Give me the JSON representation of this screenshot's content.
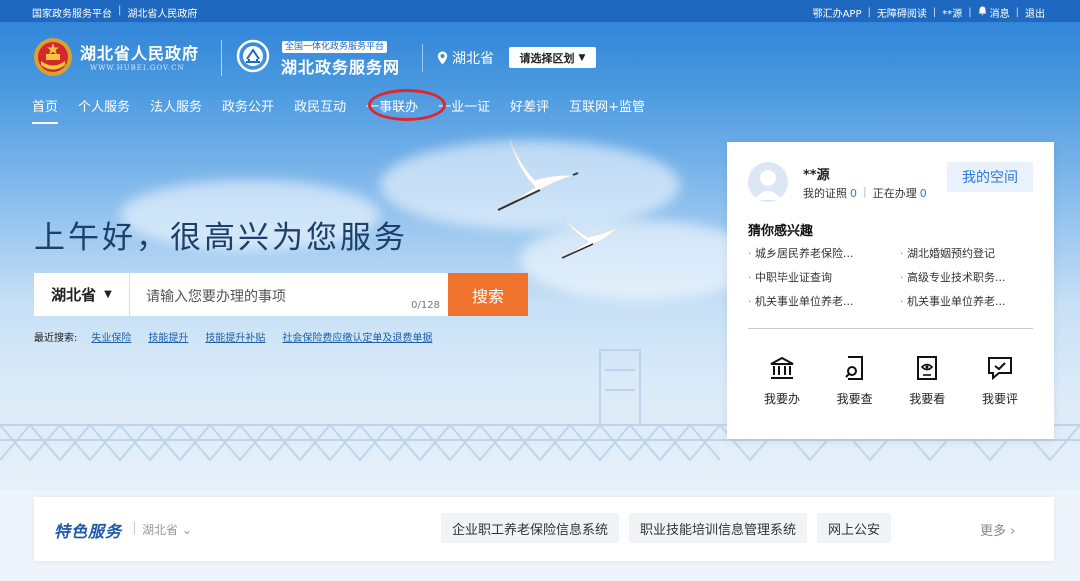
{
  "topbar": {
    "left": [
      "国家政务服务平台",
      "湖北省人民政府"
    ],
    "right": [
      "鄂汇办APP",
      "无障碍阅读",
      "**源",
      "消息",
      "退出"
    ]
  },
  "header": {
    "gov_title": "湖北省人民政府",
    "gov_url": "WWW.HUBEI.GOV.CN",
    "hall_badge": "全国一体化政务服务平台",
    "hall_title": "湖北政务服务网",
    "location": "湖北省",
    "region_select": "请选择区划"
  },
  "nav": [
    "首页",
    "个人服务",
    "法人服务",
    "政务公开",
    "政民互动",
    "一事联办",
    "一业一证",
    "好差评",
    "互联网+监管"
  ],
  "greeting": "上午好，很高兴为您服务",
  "search": {
    "region": "湖北省",
    "placeholder": "请输入您要办理的事项",
    "counter": "0/128",
    "button": "搜索"
  },
  "recent": {
    "label": "最近搜索:",
    "items": [
      "失业保险",
      "技能提升",
      "技能提升补贴",
      "社会保险费应缴认定单及退费单据"
    ]
  },
  "user_card": {
    "name": "**源",
    "cert_label": "我的证照",
    "cert_count": "0",
    "doing_label": "正在办理",
    "doing_count": "0",
    "space_button": "我的空间",
    "interest_title": "猜你感兴趣",
    "interests": [
      "城乡居民养老保险...",
      "湖北婚姻预约登记",
      "中职毕业证查询",
      "高级专业技术职务...",
      "机关事业单位养老...",
      "机关事业单位养老..."
    ],
    "actions": [
      {
        "label": "我要办",
        "icon": "building-icon"
      },
      {
        "label": "我要查",
        "icon": "search-doc-icon"
      },
      {
        "label": "我要看",
        "icon": "eye-doc-icon"
      },
      {
        "label": "我要评",
        "icon": "comment-check-icon"
      }
    ]
  },
  "special": {
    "title": "特色服务",
    "region": "湖北省",
    "tags": [
      "企业职工养老保险信息系统",
      "职业技能培训信息管理系统",
      "网上公安"
    ],
    "more": "更多"
  },
  "colors": {
    "primary": "#1f68c0",
    "search_button": "#f0732d",
    "highlight_ring": "#e0262b",
    "link": "#2a7ad9"
  }
}
